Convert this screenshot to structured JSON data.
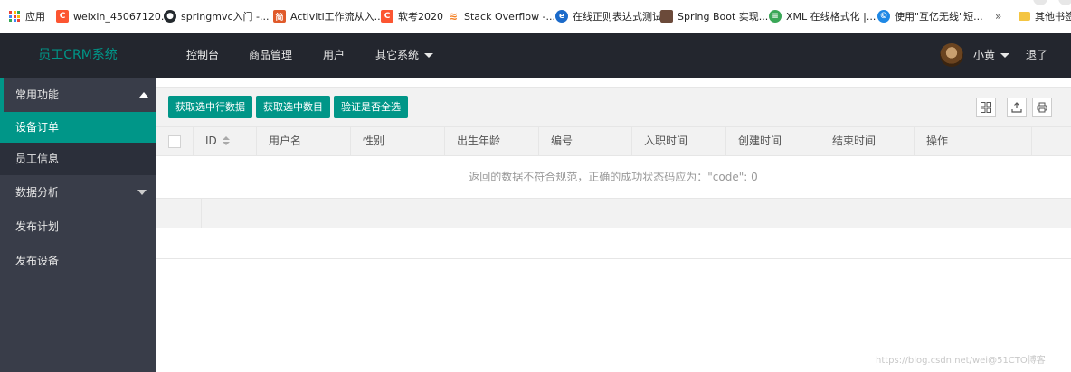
{
  "bookmarks": [
    {
      "name": "apps",
      "label": "应用",
      "icon": "apps-grid-icon"
    },
    {
      "name": "weixin",
      "label": "weixin_45067120...",
      "icon": "csdn-icon",
      "color": "#fc5531"
    },
    {
      "name": "springmvc",
      "label": "springmvc入门 -...",
      "icon": "github-icon",
      "color": "#24292e"
    },
    {
      "name": "activiti",
      "label": "Activiti工作流从入...",
      "icon": "bookmark-site-icon",
      "color": "#e05a2b"
    },
    {
      "name": "ruankao",
      "label": "软考2020",
      "icon": "csdn-icon",
      "color": "#fc5531"
    },
    {
      "name": "stackoverflow",
      "label": "Stack Overflow -...",
      "icon": "stackoverflow-icon",
      "color": "#f48024"
    },
    {
      "name": "regex",
      "label": "在线正则表达式测试",
      "icon": "edge-icon",
      "color": "#1b6ac9"
    },
    {
      "name": "springboot",
      "label": "Spring Boot 实现...",
      "icon": "image-site-icon",
      "color": "#6b4a3a"
    },
    {
      "name": "xml",
      "label": "XML 在线格式化 |...",
      "icon": "green-site-icon",
      "color": "#3aa757"
    },
    {
      "name": "cloud",
      "label": "使用\"互亿无线\"短...",
      "icon": "blue-site-icon",
      "color": "#1e88e5"
    },
    {
      "name": "more",
      "label": "»"
    },
    {
      "name": "other",
      "label": "其他书签",
      "icon": "folder-icon"
    }
  ],
  "header": {
    "logo": "员工CRM系统",
    "nav": [
      "控制台",
      "商品管理",
      "用户",
      "其它系统"
    ],
    "user": "小黄",
    "logout": "退了"
  },
  "sidebar": {
    "groups": [
      {
        "label": "常用功能",
        "expanded": true
      },
      {
        "label": "设备订单",
        "active": true
      },
      {
        "label": "员工信息"
      },
      {
        "label": "数据分析",
        "expanded": false
      },
      {
        "label": "发布计划"
      },
      {
        "label": "发布设备"
      }
    ]
  },
  "toolbar": {
    "buttons": [
      "获取选中行数据",
      "获取选中数目",
      "验证是否全选"
    ],
    "icons": [
      "columns-icon",
      "export-icon",
      "print-icon"
    ]
  },
  "table": {
    "columns": [
      "ID",
      "用户名",
      "性别",
      "出生年龄",
      "编号",
      "入职时间",
      "创建时间",
      "结束时间",
      "操作"
    ],
    "empty_text": "返回的数据不符合规范，正确的成功状态码应为：\"code\": 0"
  },
  "watermark": "https://blog.csdn.net/wei@51CTO博客",
  "colors": {
    "accent": "#009688",
    "header_bg": "#23262e",
    "sidebar_bg": "#393d49"
  }
}
